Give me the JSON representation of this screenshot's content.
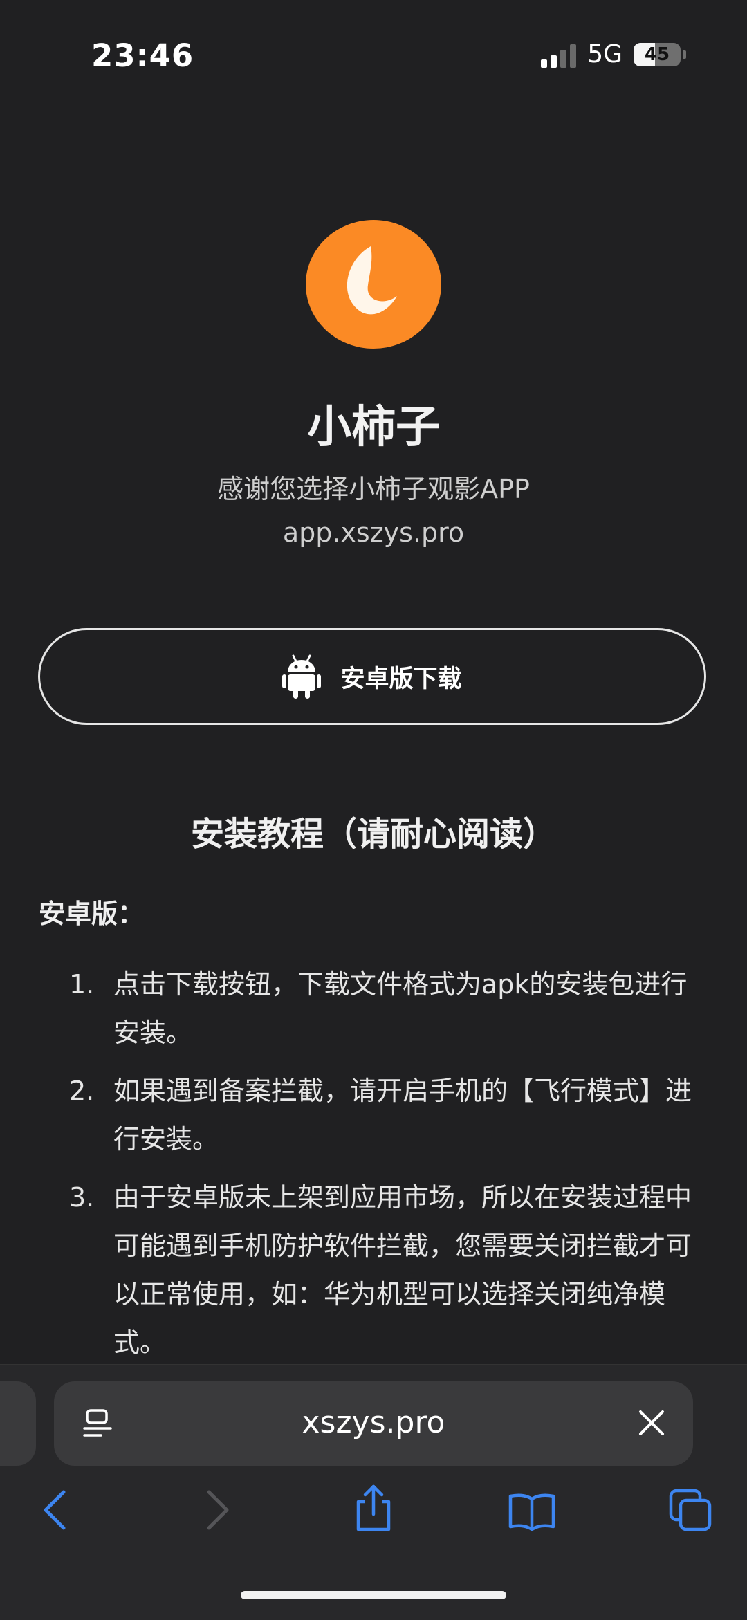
{
  "status_bar": {
    "time": "23:46",
    "network": "5G",
    "battery": "45"
  },
  "app": {
    "name": "小柿子",
    "tagline": "感谢您选择小柿子观影APP",
    "domain": "app.xszys.pro",
    "download_label": "安卓版下载"
  },
  "tutorial": {
    "title": "安装教程（请耐心阅读）",
    "android_label": "安卓版：",
    "steps": [
      {
        "num": "1.",
        "text": "点击下载按钮，下载文件格式为apk的安装包进行安装。"
      },
      {
        "num": "2.",
        "text": "如果遇到备案拦截，请开启手机的【飞行模式】进行安装。"
      },
      {
        "num": "3.",
        "text": "由于安卓版未上架到应用市场，所以在安装过程中可能遇到手机防护软件拦截，您需要关闭拦截才可以正常使用，如：华为机型可以选择关闭纯净模式。"
      }
    ]
  },
  "browser": {
    "url": "xszys.pro"
  },
  "colors": {
    "accent_orange": "#fb8a25",
    "safari_blue": "#3d85f0",
    "background": "#202022"
  },
  "icons": [
    "android-icon",
    "reader-icon",
    "close-icon",
    "back-icon",
    "forward-icon",
    "share-icon",
    "bookmarks-icon",
    "tabs-icon"
  ]
}
